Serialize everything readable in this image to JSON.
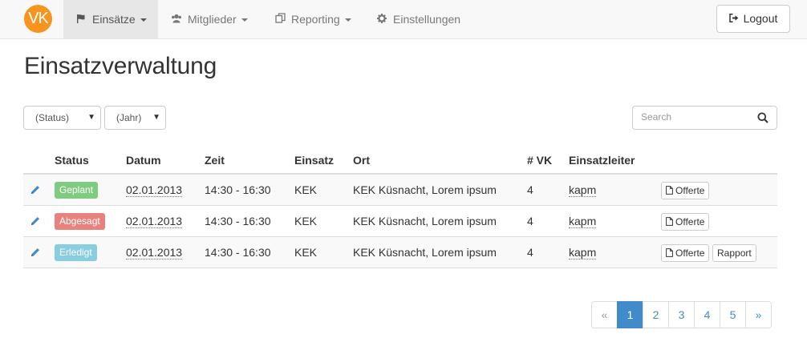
{
  "navbar": {
    "logo_text": "VK",
    "items": [
      {
        "label": "Einsätze",
        "icon": "flag-icon",
        "active": true,
        "dropdown": true
      },
      {
        "label": "Mitglieder",
        "icon": "users-icon",
        "active": false,
        "dropdown": true
      },
      {
        "label": "Reporting",
        "icon": "copy-icon",
        "active": false,
        "dropdown": true
      },
      {
        "label": "Einstellungen",
        "icon": "gear-icon",
        "active": false,
        "dropdown": false
      }
    ],
    "logout_label": "Logout"
  },
  "page_title": "Einsatzverwaltung",
  "filters": {
    "status_select": "(Status)",
    "year_select": "(Jahr)",
    "search_placeholder": "Search"
  },
  "table": {
    "headers": {
      "status": "Status",
      "datum": "Datum",
      "zeit": "Zeit",
      "einsatz": "Einsatz",
      "ort": "Ort",
      "vk": "# VK",
      "einsatzleiter": "Einsatzleiter"
    },
    "rows": [
      {
        "status": "Geplant",
        "status_color": "#7fcb7f",
        "datum": "02.01.2013",
        "zeit": "14:30 - 16:30",
        "einsatz": "KEK",
        "ort": "KEK Küsnacht, Lorem ipsum",
        "vk": "4",
        "einsatzleiter": "kapm",
        "offerte": "Offerte",
        "rapport": ""
      },
      {
        "status": "Abgesagt",
        "status_color": "#e8827f",
        "datum": "02.01.2013",
        "zeit": "14:30 - 16:30",
        "einsatz": "KEK",
        "ort": "KEK Küsnacht, Lorem ipsum",
        "vk": "4",
        "einsatzleiter": "kapm",
        "offerte": "Offerte",
        "rapport": ""
      },
      {
        "status": "Erledigt",
        "status_color": "#88cde0",
        "datum": "02.01.2013",
        "zeit": "14:30 - 16:30",
        "einsatz": "KEK",
        "ort": "KEK Küsnacht, Lorem ipsum",
        "vk": "4",
        "einsatzleiter": "kapm",
        "offerte": "Offerte",
        "rapport": "Rapport"
      }
    ]
  },
  "pagination": {
    "prev": "«",
    "pages": [
      "1",
      "2",
      "3",
      "4",
      "5"
    ],
    "active": "1",
    "next": "»"
  },
  "colors": {
    "accent": "#428bca",
    "logo": "#f7941d"
  }
}
